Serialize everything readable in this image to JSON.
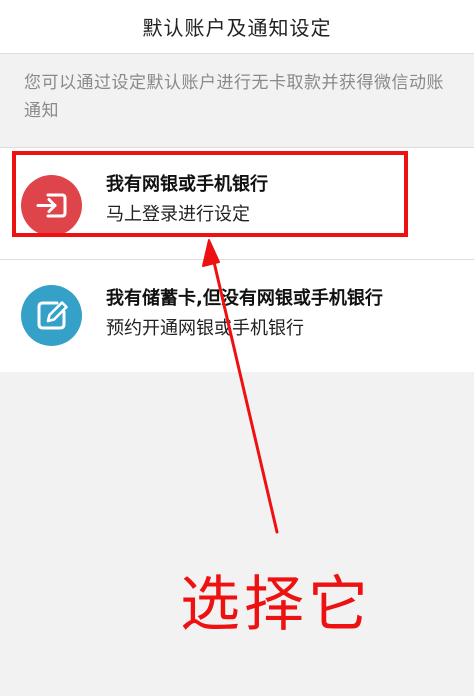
{
  "header": {
    "title": "默认账户及通知设定"
  },
  "description": "您可以通过设定默认账户进行无卡取款并获得微信动账通知",
  "options": [
    {
      "icon": "sign-in-icon",
      "title": "我有网银或手机银行",
      "subtitle": "马上登录进行设定",
      "icon_color": "#e0444b"
    },
    {
      "icon": "edit-icon",
      "title": "我有储蓄卡,但没有网银或手机银行",
      "subtitle": "预约开通网银或手机银行",
      "icon_color": "#35a1c8"
    }
  ],
  "annotation": {
    "text": "选择它",
    "color": "#ee1111"
  }
}
